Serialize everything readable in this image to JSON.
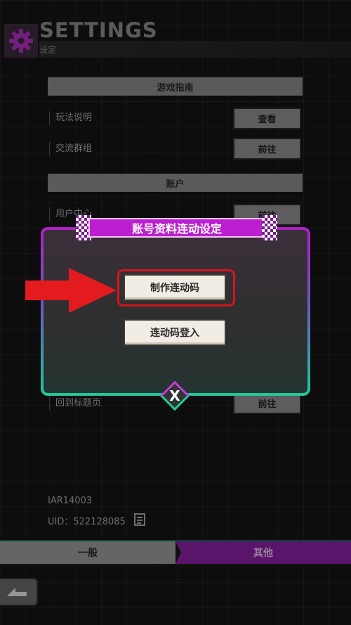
{
  "header": {
    "title": "SETTINGS",
    "subtitle": "设定"
  },
  "sections": {
    "guide": {
      "title": "游戏指南",
      "rows": [
        {
          "label": "玩法说明",
          "button": "查看"
        },
        {
          "label": "交流群组",
          "button": "前往"
        }
      ]
    },
    "account": {
      "title": "账户",
      "rows": [
        {
          "label": "用户中心",
          "button": "前往"
        },
        {
          "label": "回到标题页",
          "button": "前往"
        }
      ]
    }
  },
  "footer": {
    "account_id": "IAR14003",
    "uid": "UID：522128085"
  },
  "tabs": {
    "general": "一般",
    "other": "其他"
  },
  "modal": {
    "title": "账号资料连动设定",
    "create_code_button": "制作连动码",
    "login_code_button": "连动码登入",
    "close_label": "X"
  },
  "colors": {
    "accent_purple": "#bb1fd0",
    "accent_green": "#1fc99a",
    "highlight_red": "#d4161b"
  },
  "icons": [
    "gear-icon",
    "copy-icon",
    "back-icon",
    "close-icon",
    "arrow-pointer-icon"
  ]
}
